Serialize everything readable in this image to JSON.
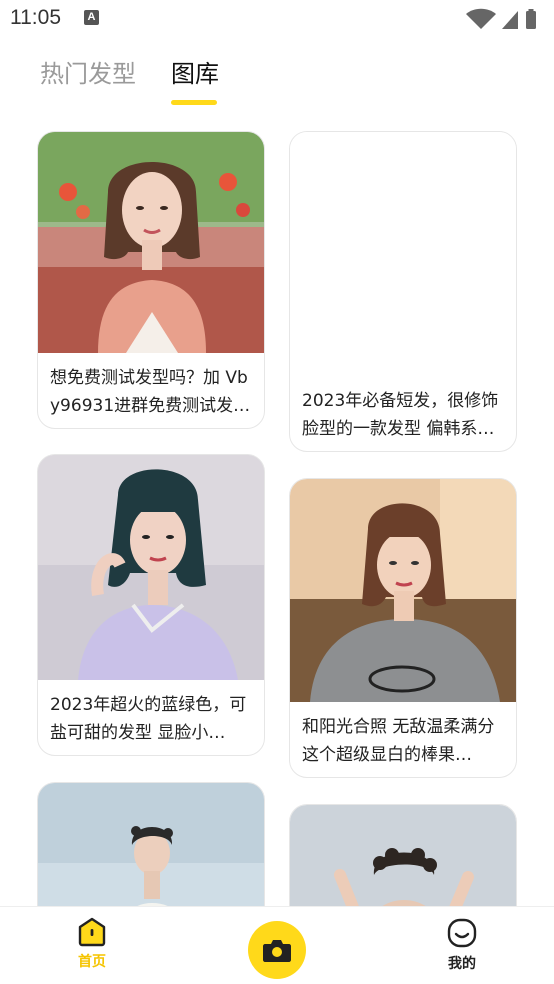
{
  "status_bar": {
    "time": "11:05",
    "notification_glyph": "A"
  },
  "tabs": [
    {
      "label": "热门发型",
      "active": false
    },
    {
      "label": "图库",
      "active": true
    }
  ],
  "cards": [
    {
      "text": "想免费测试发型吗？加 Vby96931进群免费测试发型…",
      "image": "woman-bob-pink-blazer-photo"
    },
    {
      "text": "2023年必备短发，很修饰脸型的一款发型 偏韩系…",
      "image": ""
    },
    {
      "text": "2023年超火的蓝绿色，可盐可甜的发型 显脸小…",
      "image": "woman-teal-bob-lavender-top-photo"
    },
    {
      "text": "和阳光合照 无敌温柔满分 这个超级显白的棒果…",
      "image": "woman-short-hair-sunlight-photo"
    },
    {
      "text": "",
      "image": "man-curly-hair-white-shirt-photo"
    },
    {
      "text": "",
      "image": "person-curly-hair-hands-up-photo"
    }
  ],
  "bottom_nav": {
    "home_label": "首页",
    "me_label": "我的",
    "camera_icon": "camera-icon"
  },
  "colors": {
    "accent": "#FFD91A",
    "home_active": "#F5C400",
    "inactive_tab": "#9a9a9a"
  }
}
